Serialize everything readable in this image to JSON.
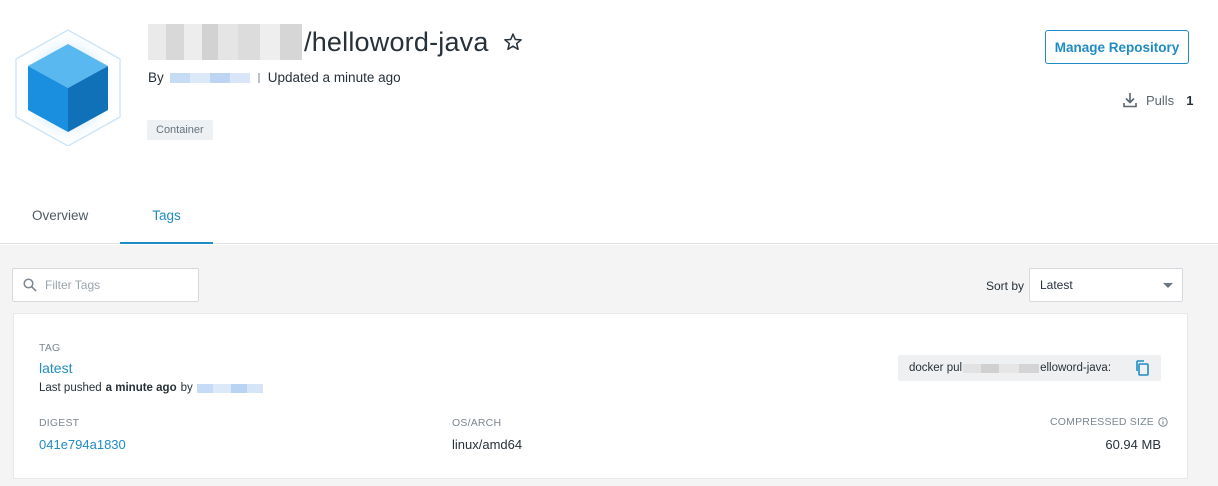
{
  "repo": {
    "name": "/helloword-java",
    "by_label": "By",
    "updated": "Updated a minute ago",
    "badge": "Container"
  },
  "header_actions": {
    "manage_label": "Manage Repository",
    "pulls_label": "Pulls",
    "pulls_count": "1"
  },
  "tabs": [
    {
      "label": "Overview",
      "active": false
    },
    {
      "label": "Tags",
      "active": true
    }
  ],
  "filters": {
    "filter_placeholder": "Filter Tags",
    "sort_label": "Sort by",
    "sort_value": "Latest"
  },
  "tag_card": {
    "tag_label": "TAG",
    "tag_name": "latest",
    "pushed_prefix": "Last pushed",
    "pushed_time": "a minute ago",
    "pushed_by": "by",
    "pull_command_prefix": "docker pul",
    "pull_command_suffix": "elloword-java:",
    "digest_label": "DIGEST",
    "digest_value": "041e794a1830",
    "osarch_label": "OS/ARCH",
    "osarch_value": "linux/amd64",
    "size_label": "COMPRESSED SIZE",
    "size_value": "60.94 MB"
  },
  "colors": {
    "accent": "#1f8cc4",
    "cube_light": "#5ab8f0",
    "cube_mid": "#1a8fe0",
    "cube_dark": "#1171b8"
  },
  "icons": [
    "cube-logo-icon",
    "star-icon",
    "download-icon",
    "search-icon",
    "caret-down-icon",
    "copy-icon",
    "info-icon"
  ]
}
